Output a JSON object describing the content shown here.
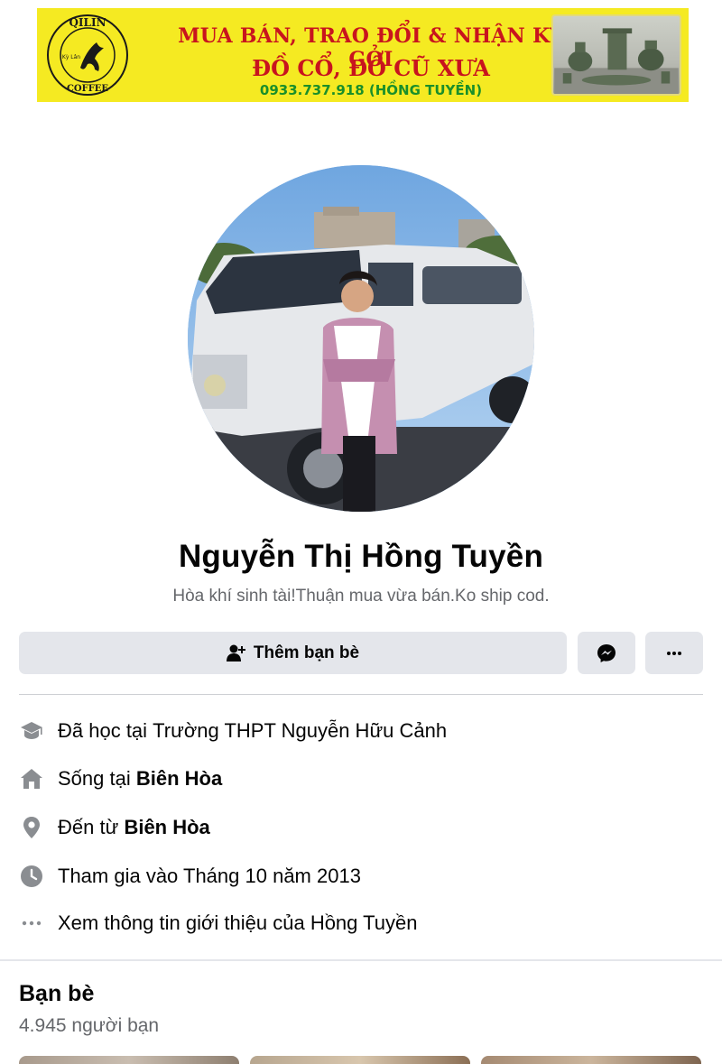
{
  "banner": {
    "logo_top_text": "QILIN",
    "logo_bottom_text": "COFFEE",
    "logo_small_text": "Kỳ Lân",
    "line1": "MUA BÁN, TRAO ĐỔI & NHẬN KÝ GỞI",
    "line2": "ĐỒ CỔ, ĐỒ CŨ XƯA",
    "phone": "0933.737.918 (HỒNG TUYỀN)",
    "colors": {
      "background": "#f5ea22",
      "headline": "#c8141e",
      "phone": "#1a8f2a"
    }
  },
  "profile": {
    "name": "Nguyễn Thị Hồng Tuyền",
    "bio": "Hòa khí sinh tài!Thuận mua vừa bán.Ko ship cod."
  },
  "actions": {
    "add_friend_label": "Thêm bạn bè",
    "add_friend_icon": "add-friend-icon",
    "messenger_icon": "messenger-icon",
    "more_icon": "more-icon",
    "more_label": "···"
  },
  "intro": {
    "education_prefix": "Đã học tại ",
    "education_value": "Trường THPT Nguyễn Hữu Cảnh",
    "lives_prefix": "Sống tại ",
    "lives_value": "Biên Hòa",
    "from_prefix": "Đến từ ",
    "from_value": "Biên Hòa",
    "joined": "Tham gia vào Tháng 10 năm 2013",
    "see_about": "Xem thông tin giới thiệu của Hồng Tuyền"
  },
  "friends": {
    "title": "Bạn bè",
    "count": "4.945 người bạn"
  },
  "colors": {
    "button_bg": "#e4e6eb",
    "secondary_text": "#65676b",
    "icon_gray": "#65676b"
  }
}
